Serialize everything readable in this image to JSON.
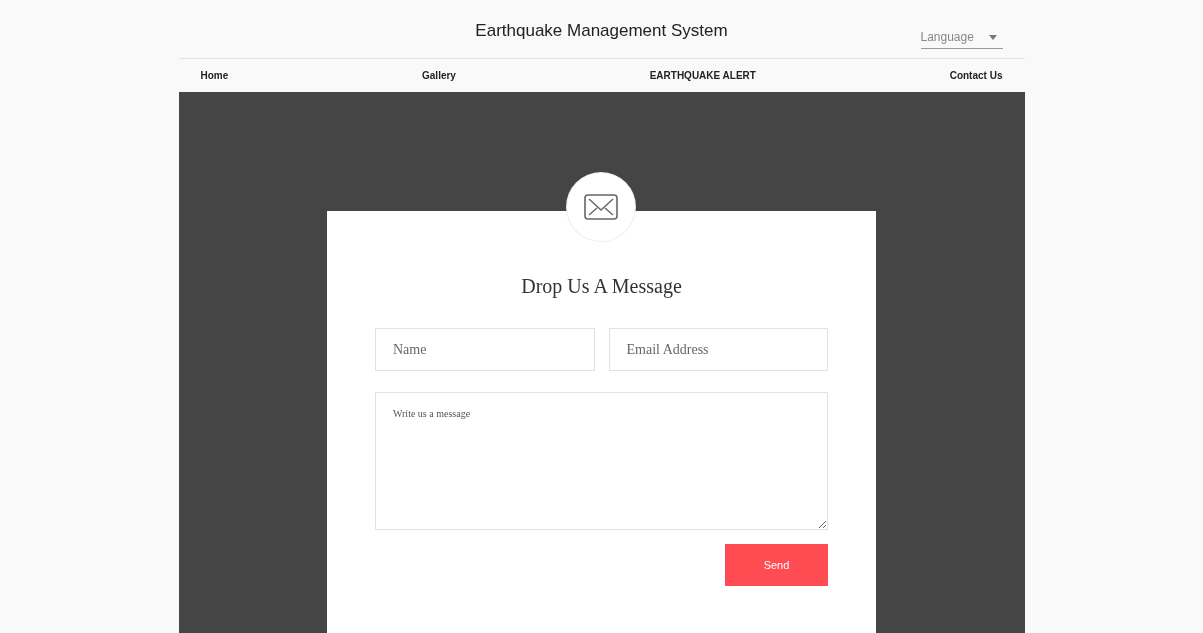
{
  "header": {
    "title": "Earthquake Management System",
    "language_select": {
      "placeholder": "Language"
    }
  },
  "nav": [
    {
      "label": "Home"
    },
    {
      "label": "Gallery"
    },
    {
      "label": "EARTHQUAKE ALERT"
    },
    {
      "label": "Contact Us"
    }
  ],
  "contact_form": {
    "title": "Drop Us A Message",
    "fields": [
      {
        "placeholder": "Name"
      },
      {
        "placeholder": "Email Address"
      }
    ],
    "message": {
      "placeholder": "Write us a message"
    },
    "submit": "Send"
  }
}
